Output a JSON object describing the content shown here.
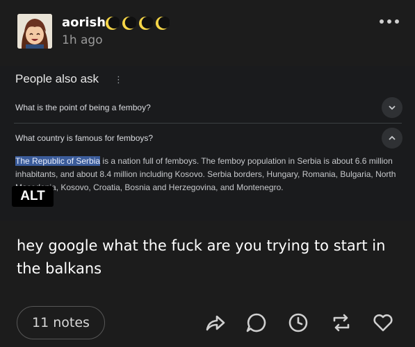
{
  "post": {
    "author": {
      "username": "aorish",
      "badges": [
        "crescent-moon-icon",
        "crescent-moon-icon",
        "crescent-moon-icon",
        "crescent-moon-icon"
      ],
      "timestamp": "1h ago"
    },
    "image": {
      "alt_badge": "ALT",
      "people_also_ask": {
        "title": "People also ask",
        "questions": [
          {
            "text": "What is the point of being a femboy?",
            "expanded": false
          },
          {
            "text": "What country is famous for femboys?",
            "expanded": true
          }
        ],
        "answer": {
          "highlight": "The Republic of Serbia",
          "rest": " is a nation full of femboys. The femboy population in Serbia is about 6.6 million inhabitants, and about 8.4 million including Kosovo. Serbia borders, Hungary, Romania, Bulgaria, North Macedonia, Kosovo, Croatia, Bosnia and Herzegovina, and Montenegro."
        }
      }
    },
    "text": "hey google what the fuck are you trying to start in the balkans",
    "notes_label": "11 notes",
    "actions": [
      "share-icon",
      "reply-icon",
      "schedule-icon",
      "reblog-icon",
      "like-icon"
    ]
  },
  "colors": {
    "background": "#1c1c1c",
    "highlight": "#3b5c9a",
    "muted_text": "#9a9a9a"
  }
}
